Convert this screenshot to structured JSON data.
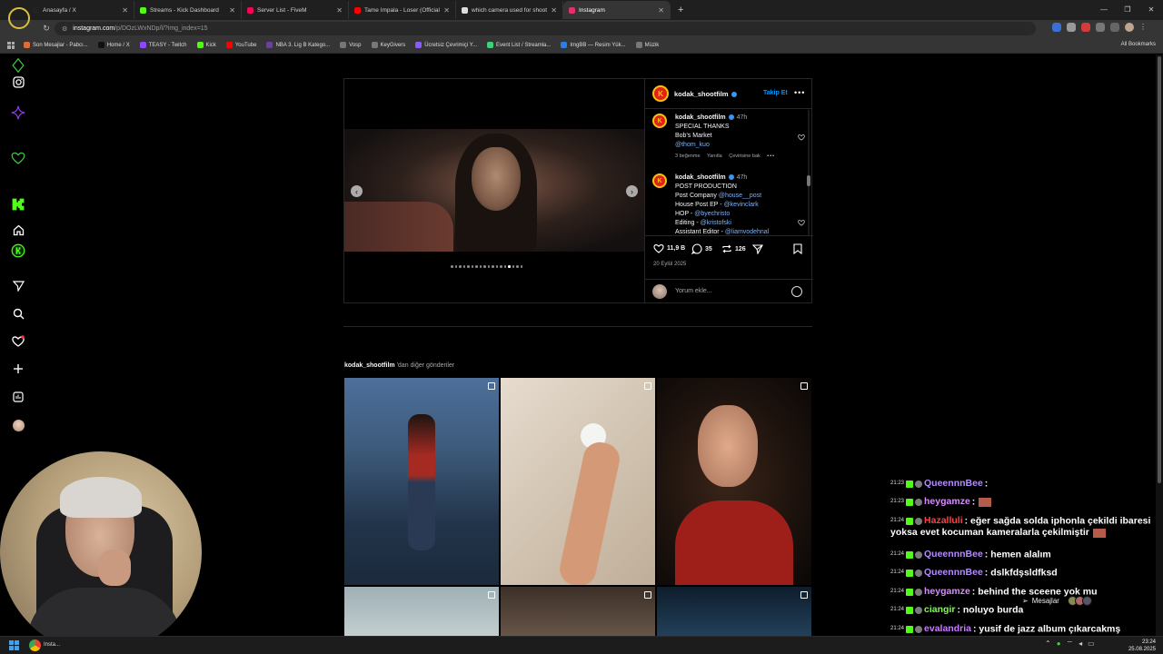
{
  "browser": {
    "tabs": [
      {
        "label": "Anasayfa / X",
        "color": "#222",
        "active": false
      },
      {
        "label": "Streams - Kick Dashboard",
        "color": "#53fc18",
        "active": false
      },
      {
        "label": "Server List - FiveM",
        "color": "#f40552",
        "active": false
      },
      {
        "label": "Tame Impala - Loser (Official V",
        "color": "#ff0000",
        "active": false
      },
      {
        "label": "which camera used for shootin",
        "color": "#dddddd",
        "active": false
      },
      {
        "label": "Instagram",
        "color": "#e1306c",
        "active": true
      }
    ],
    "new_tab": "+",
    "url_host": "instagram.com",
    "url_path": "/p/DOzLWxNDp/l/?img_index=15",
    "bookmarks": [
      {
        "label": "Son Mesajlar - Pabcı...",
        "color": "#e06a3a"
      },
      {
        "label": "Home / X",
        "color": "#111111"
      },
      {
        "label": "TEASY - Twitch",
        "color": "#9146ff"
      },
      {
        "label": "Kick",
        "color": "#53fc18"
      },
      {
        "label": "YouTube",
        "color": "#ff0000"
      },
      {
        "label": "NBA 3. Lig B Katego...",
        "color": "#6b3fa0"
      },
      {
        "label": "Vosp",
        "color": "#777777"
      },
      {
        "label": "KeyGivers",
        "color": "#777777"
      },
      {
        "label": "Ücretsiz Çevrimiçi Y...",
        "color": "#8a5cf6"
      },
      {
        "label": "Event List / Streamla...",
        "color": "#3dd17a"
      },
      {
        "label": "ImgBB — Resim Yük...",
        "color": "#2a7fe0"
      },
      {
        "label": "Müzik",
        "color": "#777777"
      }
    ],
    "all_bookmarks": "All Bookmarks"
  },
  "post": {
    "username": "kodak_shootfilm",
    "follow_label": "Takip Et",
    "carousel_dots": 18,
    "active_dot": 14,
    "comments": [
      {
        "user": "kodak_shootfilm",
        "time": "47h",
        "lines": [
          "SPECIAL THANKS",
          "Bob's Market"
        ],
        "mentions": [
          "@thom_kuo"
        ],
        "likes": "3 beğenme",
        "reply": "Yanıtla",
        "translate": "Çevirisine bak"
      },
      {
        "user": "kodak_shootfilm",
        "time": "47h",
        "line1": "POST PRODUCTION",
        "line2_prefix": "Post Company ",
        "line2_mention": "@house__post",
        "line3_prefix": "House Post EP - ",
        "line3_mention": "@kevinclark",
        "line4_prefix": "HOP - ",
        "line4_mention": "@byechristo",
        "line5_prefix": "Editing - ",
        "line5_mention": "@kristofski",
        "line6_prefix": "Assistant Editor - ",
        "line6_mention": "@liamvodehnal"
      }
    ],
    "likes_count": "11,9 B",
    "comment_count": "35",
    "share_count": "126",
    "date": "20 Eylül 2025",
    "add_comment_placeholder": "Yorum ekle..."
  },
  "more_posts": {
    "user": "kodak_shootfilm",
    "suffix": " 'dan diğer gönderiler"
  },
  "chat": [
    {
      "time": "21:23",
      "user": "QueennnBee",
      "user_color": "#b58bff",
      "msg": ":"
    },
    {
      "time": "21:23",
      "user": "heygamze",
      "user_color": "#d98cff",
      "msg": ":"
    },
    {
      "time": "21:24",
      "user": "Hazalluli",
      "user_color": "#ff4040",
      "msg": ": eğer sağda solda iphonla çekildi ibaresi yoksa evet kocuman kameralarla çekilmiştir"
    },
    {
      "time": "21:24",
      "user": "QueennnBee",
      "user_color": "#b58bff",
      "msg": ": hemen alalım"
    },
    {
      "time": "21:24",
      "user": "QueennnBee",
      "user_color": "#b58bff",
      "msg": ": dslkfdşsldfksd"
    },
    {
      "time": "21:24",
      "user": "heygamze",
      "user_color": "#d98cff",
      "msg": ": behind the sceene yok mu"
    },
    {
      "time": "21:24",
      "user": "ciangir",
      "user_color": "#7cff4a",
      "msg": ": noluyo burda"
    },
    {
      "time": "21:24",
      "user": "evalandria",
      "user_color": "#c77dff",
      "msg": ": yusif de jazz album çıkarcakmş sseneye nbggjfh benim bilgilerrr"
    }
  ],
  "messages_label": "Mesajlar",
  "taskbar": {
    "app_label": "Insta...",
    "time": "23:24",
    "date": "25.08.2025"
  },
  "colors": {
    "accent_blue": "#0095f6",
    "kodak_red": "#e2211c",
    "kodak_yellow": "#f9c30a"
  }
}
